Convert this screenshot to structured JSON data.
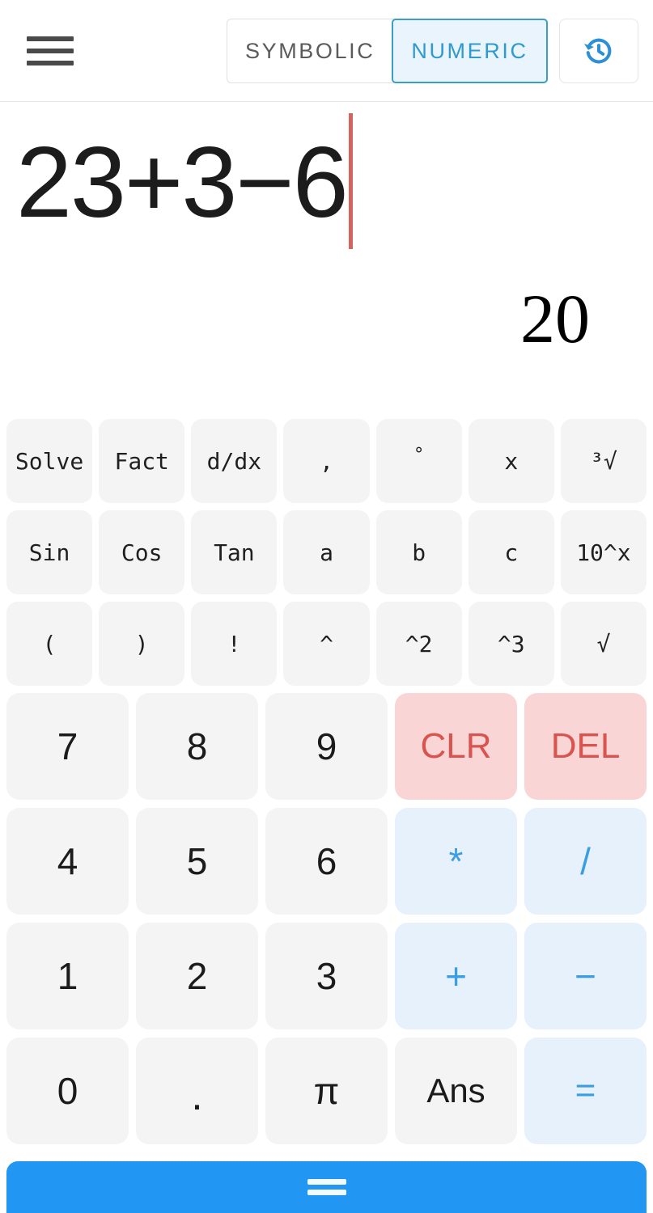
{
  "header": {
    "menu_icon": "hamburger-menu-icon",
    "modes": [
      {
        "label": "SYMBOLIC",
        "active": false
      },
      {
        "label": "NUMERIC",
        "active": true
      }
    ],
    "history_icon": "history-icon",
    "accent_color": "#3b9ec9",
    "active_mode_bg": "#eaf4fd"
  },
  "display": {
    "expression": "23+3−6",
    "cursor_color": "#d2665f",
    "result": "20"
  },
  "function_keys": {
    "row1": [
      {
        "label": "Solve",
        "name": "key-solve"
      },
      {
        "label": "Fact",
        "name": "key-fact"
      },
      {
        "label": "d/dx",
        "name": "key-ddx"
      },
      {
        "label": ",",
        "name": "key-comma"
      },
      {
        "label": "°",
        "name": "key-degree"
      },
      {
        "label": "x",
        "name": "key-variable-x"
      },
      {
        "label": "³√",
        "name": "key-cube-root"
      }
    ],
    "row2": [
      {
        "label": "Sin",
        "name": "key-sin"
      },
      {
        "label": "Cos",
        "name": "key-cos"
      },
      {
        "label": "Tan",
        "name": "key-tan"
      },
      {
        "label": "a",
        "name": "key-variable-a"
      },
      {
        "label": "b",
        "name": "key-variable-b"
      },
      {
        "label": "c",
        "name": "key-variable-c"
      },
      {
        "label": "10^x",
        "name": "key-ten-power-x"
      }
    ],
    "row3": [
      {
        "label": "(",
        "name": "key-open-paren"
      },
      {
        "label": ")",
        "name": "key-close-paren"
      },
      {
        "label": "!",
        "name": "key-factorial"
      },
      {
        "label": "^",
        "name": "key-power"
      },
      {
        "label": "^2",
        "name": "key-square"
      },
      {
        "label": "^3",
        "name": "key-cube"
      },
      {
        "label": "√",
        "name": "key-square-root"
      }
    ]
  },
  "keypad": {
    "row1": [
      {
        "label": "7",
        "name": "key-7",
        "style": "digit"
      },
      {
        "label": "8",
        "name": "key-8",
        "style": "digit"
      },
      {
        "label": "9",
        "name": "key-9",
        "style": "digit"
      },
      {
        "label": "CLR",
        "name": "key-clear",
        "style": "danger"
      },
      {
        "label": "DEL",
        "name": "key-delete",
        "style": "danger"
      }
    ],
    "row2": [
      {
        "label": "4",
        "name": "key-4",
        "style": "digit"
      },
      {
        "label": "5",
        "name": "key-5",
        "style": "digit"
      },
      {
        "label": "6",
        "name": "key-6",
        "style": "digit"
      },
      {
        "label": "*",
        "name": "key-multiply",
        "style": "op"
      },
      {
        "label": "/",
        "name": "key-divide",
        "style": "op"
      }
    ],
    "row3": [
      {
        "label": "1",
        "name": "key-1",
        "style": "digit"
      },
      {
        "label": "2",
        "name": "key-2",
        "style": "digit"
      },
      {
        "label": "3",
        "name": "key-3",
        "style": "digit"
      },
      {
        "label": "+",
        "name": "key-plus",
        "style": "op"
      },
      {
        "label": "−",
        "name": "key-minus",
        "style": "op"
      }
    ],
    "row4": [
      {
        "label": "0",
        "name": "key-0",
        "style": "digit"
      },
      {
        "label": ".",
        "name": "key-decimal",
        "style": "dot"
      },
      {
        "label": "π",
        "name": "key-pi",
        "style": "digit"
      },
      {
        "label": "Ans",
        "name": "key-answer",
        "style": "ans"
      },
      {
        "label": "=",
        "name": "key-equals",
        "style": "op equals"
      }
    ],
    "colors": {
      "digit_bg": "#f4f4f4",
      "danger_bg": "#fad5d5",
      "danger_fg": "#d9534f",
      "operator_bg": "#e6f1fc",
      "operator_fg": "#3b9ee0"
    }
  },
  "navbar": {
    "handle_icon": "equals-handle-icon",
    "background": "#2196f3"
  }
}
